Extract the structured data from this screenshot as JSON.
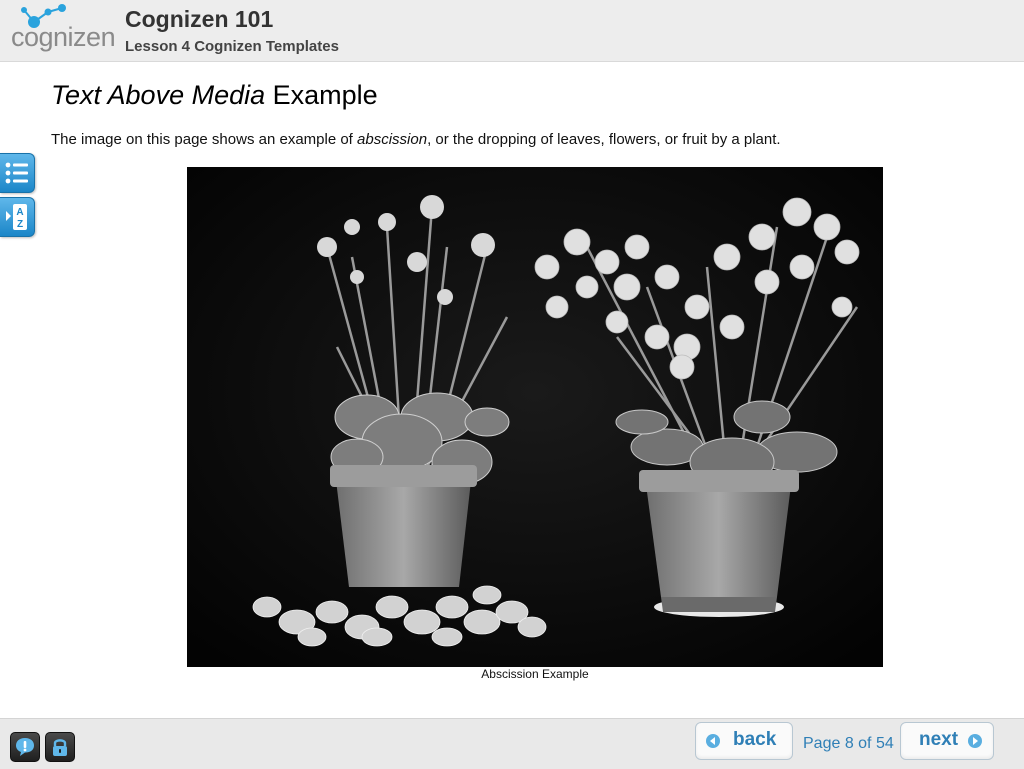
{
  "header": {
    "logo_text": "cognizen",
    "course_title": "Cognizen 101",
    "lesson_title": "Lesson 4 Cognizen Templates"
  },
  "content": {
    "title_italic": "Text Above Media",
    "title_rest": " Example",
    "intro_prefix": "The image on this page shows an example of ",
    "intro_italic": "abscission",
    "intro_suffix": ", or the dropping of leaves, flowers, or fruit by a plant.",
    "media_caption": "Abscission Example"
  },
  "side_tools": [
    {
      "icon": "list-icon"
    },
    {
      "icon": "glossary-az-icon"
    }
  ],
  "footer": {
    "help_icon": "help-bubble-icon",
    "lock_icon": "lock-icon",
    "back_label": "back",
    "next_label": "next",
    "page_indicator": "Page 8 of 54"
  },
  "colors": {
    "accent": "#2f7fb6",
    "tool_blue": "#1b86c8",
    "header_bg": "#ededed"
  }
}
